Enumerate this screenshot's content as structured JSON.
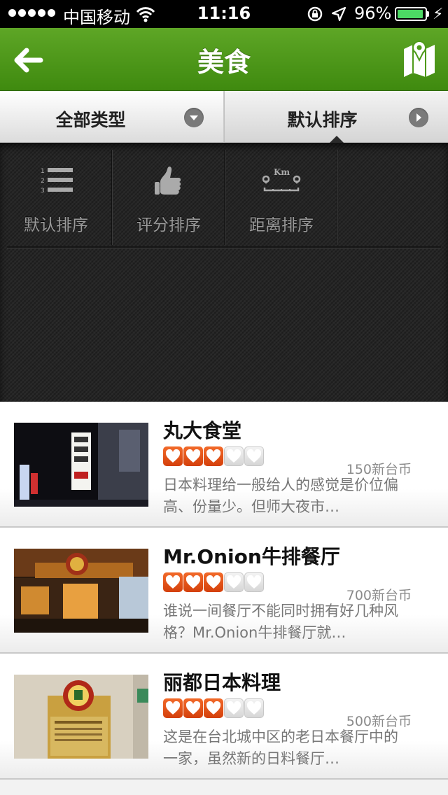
{
  "status_bar": {
    "carrier": "中国移动",
    "time": "11:16",
    "battery": "96%",
    "battery_level": 0.96
  },
  "nav": {
    "title": "美食"
  },
  "filters": {
    "type_label": "全部类型",
    "sort_label": "默认排序"
  },
  "sort_options": [
    {
      "label": "默认排序",
      "icon": "numbered-list-icon"
    },
    {
      "label": "评分排序",
      "icon": "thumbs-up-icon"
    },
    {
      "label": "距离排序",
      "icon": "distance-km-icon",
      "icon_text": "Km"
    }
  ],
  "restaurants": [
    {
      "name": "丸大食堂",
      "rating": 3,
      "rating_max": 5,
      "price": "150新台币",
      "description": "日本料理给一般给人的感觉是价位偏高、份量少。但师大夜市…"
    },
    {
      "name": "Mr.Onion牛排餐厅",
      "rating": 3,
      "rating_max": 5,
      "price": "700新台币",
      "description": "谁说一间餐厅不能同时拥有好几种风格？Mr.Onion牛排餐厅就…"
    },
    {
      "name": "丽都日本料理",
      "rating": 3,
      "rating_max": 5,
      "price": "500新台币",
      "description": "这是在台北城中区的老日本餐厅中的一家，虽然新的日料餐厅…"
    }
  ],
  "colors": {
    "nav_green": "#4f9a1a",
    "heart_on": "#e4531a",
    "battery_green": "#4cd964"
  }
}
